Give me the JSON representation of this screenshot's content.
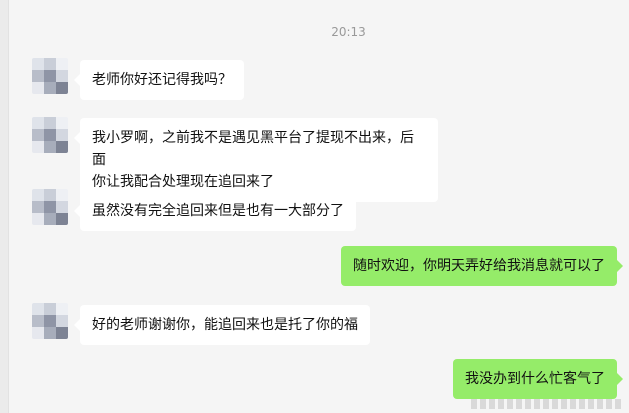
{
  "timestamp": "20:13",
  "messages": [
    {
      "side": "in",
      "text": "老师你好还记得我吗？"
    },
    {
      "side": "in",
      "line1": "我小罗啊，之前我不是遇见黑平台了提现不出来，后面",
      "line2": "你让我配合处理现在追回来了"
    },
    {
      "side": "in",
      "text": "虽然没有完全追回来但是也有一大部分了"
    },
    {
      "side": "out",
      "text": "随时欢迎，你明天弄好给我消息就可以了"
    },
    {
      "side": "in",
      "text": "好的老师谢谢你，能追回来也是托了你的福"
    },
    {
      "side": "out",
      "text": "我没办到什么忙客气了"
    }
  ],
  "colors": {
    "background": "#f5f5f5",
    "incoming_bubble": "#ffffff",
    "outgoing_bubble": "#95ec69",
    "timestamp": "#999999"
  },
  "icons": [
    "avatar-pixelated"
  ]
}
